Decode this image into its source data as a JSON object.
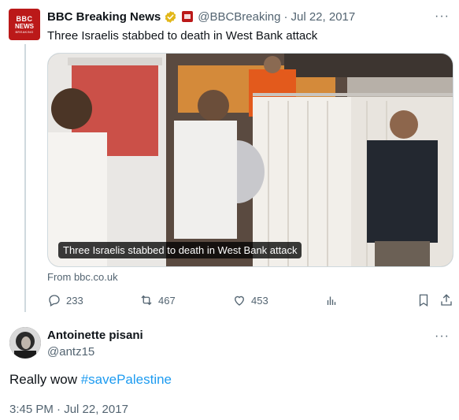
{
  "tweet": {
    "avatar": {
      "line1": "BBC",
      "line2": "NEWS",
      "line3": "BREAKING"
    },
    "name": "BBC Breaking News",
    "verified_icon": "gold-verified-badge-icon",
    "affiliation_icon": "bbc-affiliate-badge-icon",
    "handle": "@BBCBreaking",
    "separator": "·",
    "date": "Jul 22, 2017",
    "more_icon": "ellipsis-icon",
    "more_label": "···",
    "text": "Three Israelis stabbed to death in West Bank attack",
    "card": {
      "caption": "Three Israelis stabbed to death in West Bank attack",
      "source": "From bbc.co.uk",
      "image": "photo of paramedics beside an ambulance and a white screen"
    },
    "actions": {
      "replies": {
        "icon": "reply-icon",
        "count": "233"
      },
      "retweets": {
        "icon": "retweet-icon",
        "count": "467"
      },
      "likes": {
        "icon": "heart-icon",
        "count": "453"
      },
      "views": {
        "icon": "analytics-icon"
      },
      "bookmark": {
        "icon": "bookmark-icon"
      },
      "share": {
        "icon": "share-icon"
      }
    }
  },
  "reply": {
    "name": "Antoinette pisani",
    "handle": "@antz15",
    "more_label": "···",
    "text_prefix": "Really wow ",
    "hashtag": "#savePalestine",
    "timestamp": "3:45 PM · Jul 22, 2017"
  },
  "colors": {
    "accent_link": "#1d9bf0",
    "secondary_text": "#536471",
    "bbc_red": "#bb1919",
    "verified_gold": "#e2b719"
  }
}
